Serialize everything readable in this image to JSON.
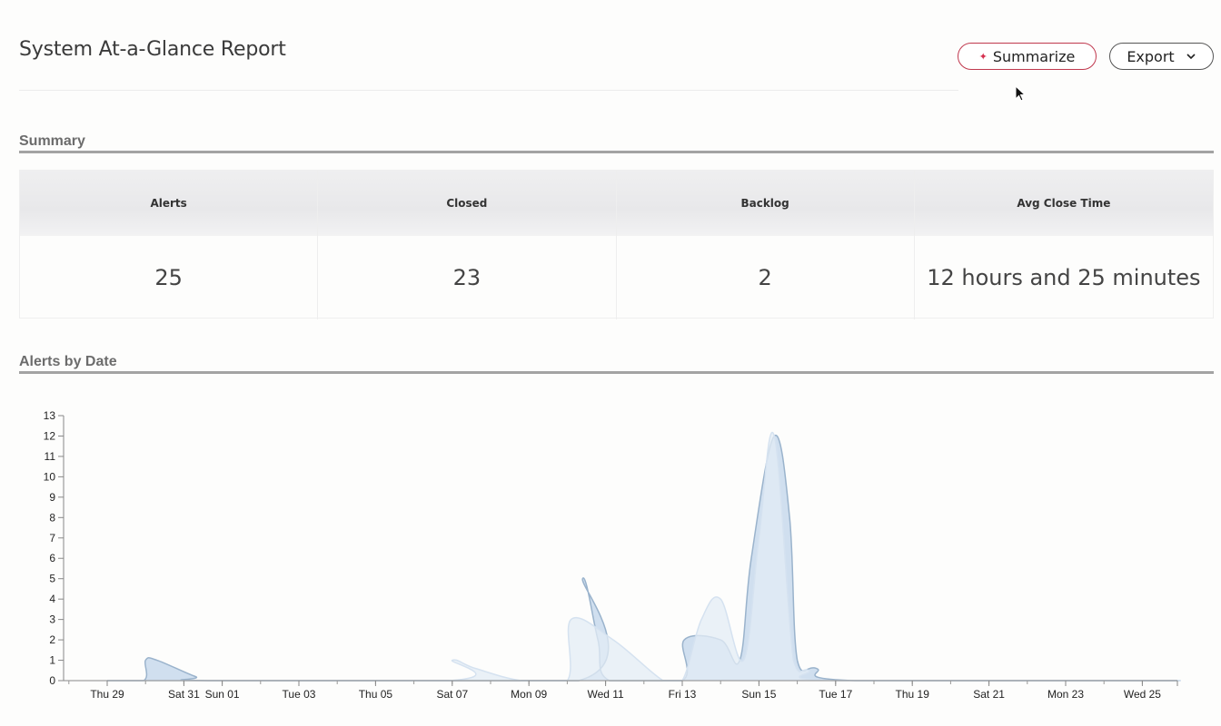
{
  "header": {
    "title": "System At-a-Glance Report",
    "summarize_label": "Summarize",
    "export_label": "Export"
  },
  "summary": {
    "heading": "Summary",
    "columns": [
      {
        "label": "Alerts",
        "value": "25"
      },
      {
        "label": "Closed",
        "value": "23"
      },
      {
        "label": "Backlog",
        "value": "2"
      },
      {
        "label": "Avg Close Time",
        "value": "12 hours and 25 minutes"
      }
    ]
  },
  "alerts_section": {
    "heading": "Alerts by Date"
  },
  "chart_data": {
    "type": "area",
    "title": "",
    "xlabel": "",
    "ylabel": "",
    "ylim": [
      0,
      13
    ],
    "yticks": [
      0,
      1,
      2,
      3,
      4,
      5,
      6,
      7,
      8,
      9,
      10,
      11,
      12,
      13
    ],
    "x_tick_labels": [
      "Thu 29",
      "Sat 31",
      "Sun 01",
      "Tue 03",
      "Thu 05",
      "Sat 07",
      "Mon 09",
      "Wed 11",
      "Fri 13",
      "Sun 15",
      "Tue 17",
      "Thu 19",
      "Sat 21",
      "Mon 23",
      "Wed 25"
    ],
    "x_tick_days": [
      0,
      2,
      3,
      5,
      7,
      9,
      11,
      13,
      15,
      17,
      19,
      21,
      23,
      25,
      27
    ],
    "grid": false,
    "legend": "none",
    "colors": {
      "series_dark": "#c8d9ec",
      "series_light": "#e3ecf6",
      "stroke_dark": "#9ab3cc",
      "stroke_light": "#d5e2f0"
    },
    "series": [
      {
        "points": [
          [
            0.0,
            0
          ],
          [
            0.95,
            0
          ],
          [
            1.0,
            1
          ],
          [
            1.3,
            1
          ],
          [
            2.3,
            0.2
          ],
          [
            2.8,
            0
          ],
          [
            12.3,
            0
          ],
          [
            12.4,
            5
          ],
          [
            12.8,
            2
          ],
          [
            13.1,
            0
          ],
          [
            15.0,
            0
          ],
          [
            15.05,
            2
          ],
          [
            16.0,
            2
          ],
          [
            16.5,
            1
          ],
          [
            16.8,
            6
          ],
          [
            17.4,
            12
          ],
          [
            17.8,
            8
          ],
          [
            18.0,
            1
          ],
          [
            18.5,
            0.6
          ],
          [
            19.5,
            0
          ],
          [
            28.0,
            0
          ]
        ]
      },
      {
        "points": [
          [
            0.0,
            0
          ],
          [
            8.9,
            0
          ],
          [
            9.0,
            1
          ],
          [
            9.6,
            0.6
          ],
          [
            10.8,
            0
          ],
          [
            12.0,
            0
          ],
          [
            12.1,
            3
          ],
          [
            13.2,
            2
          ],
          [
            14.5,
            0
          ],
          [
            15.0,
            0
          ],
          [
            15.5,
            3
          ],
          [
            16.0,
            4
          ],
          [
            16.6,
            1
          ],
          [
            17.0,
            7
          ],
          [
            17.4,
            12
          ],
          [
            17.9,
            1
          ],
          [
            18.3,
            0.5
          ],
          [
            19.0,
            0
          ],
          [
            28.0,
            0
          ]
        ]
      }
    ]
  }
}
